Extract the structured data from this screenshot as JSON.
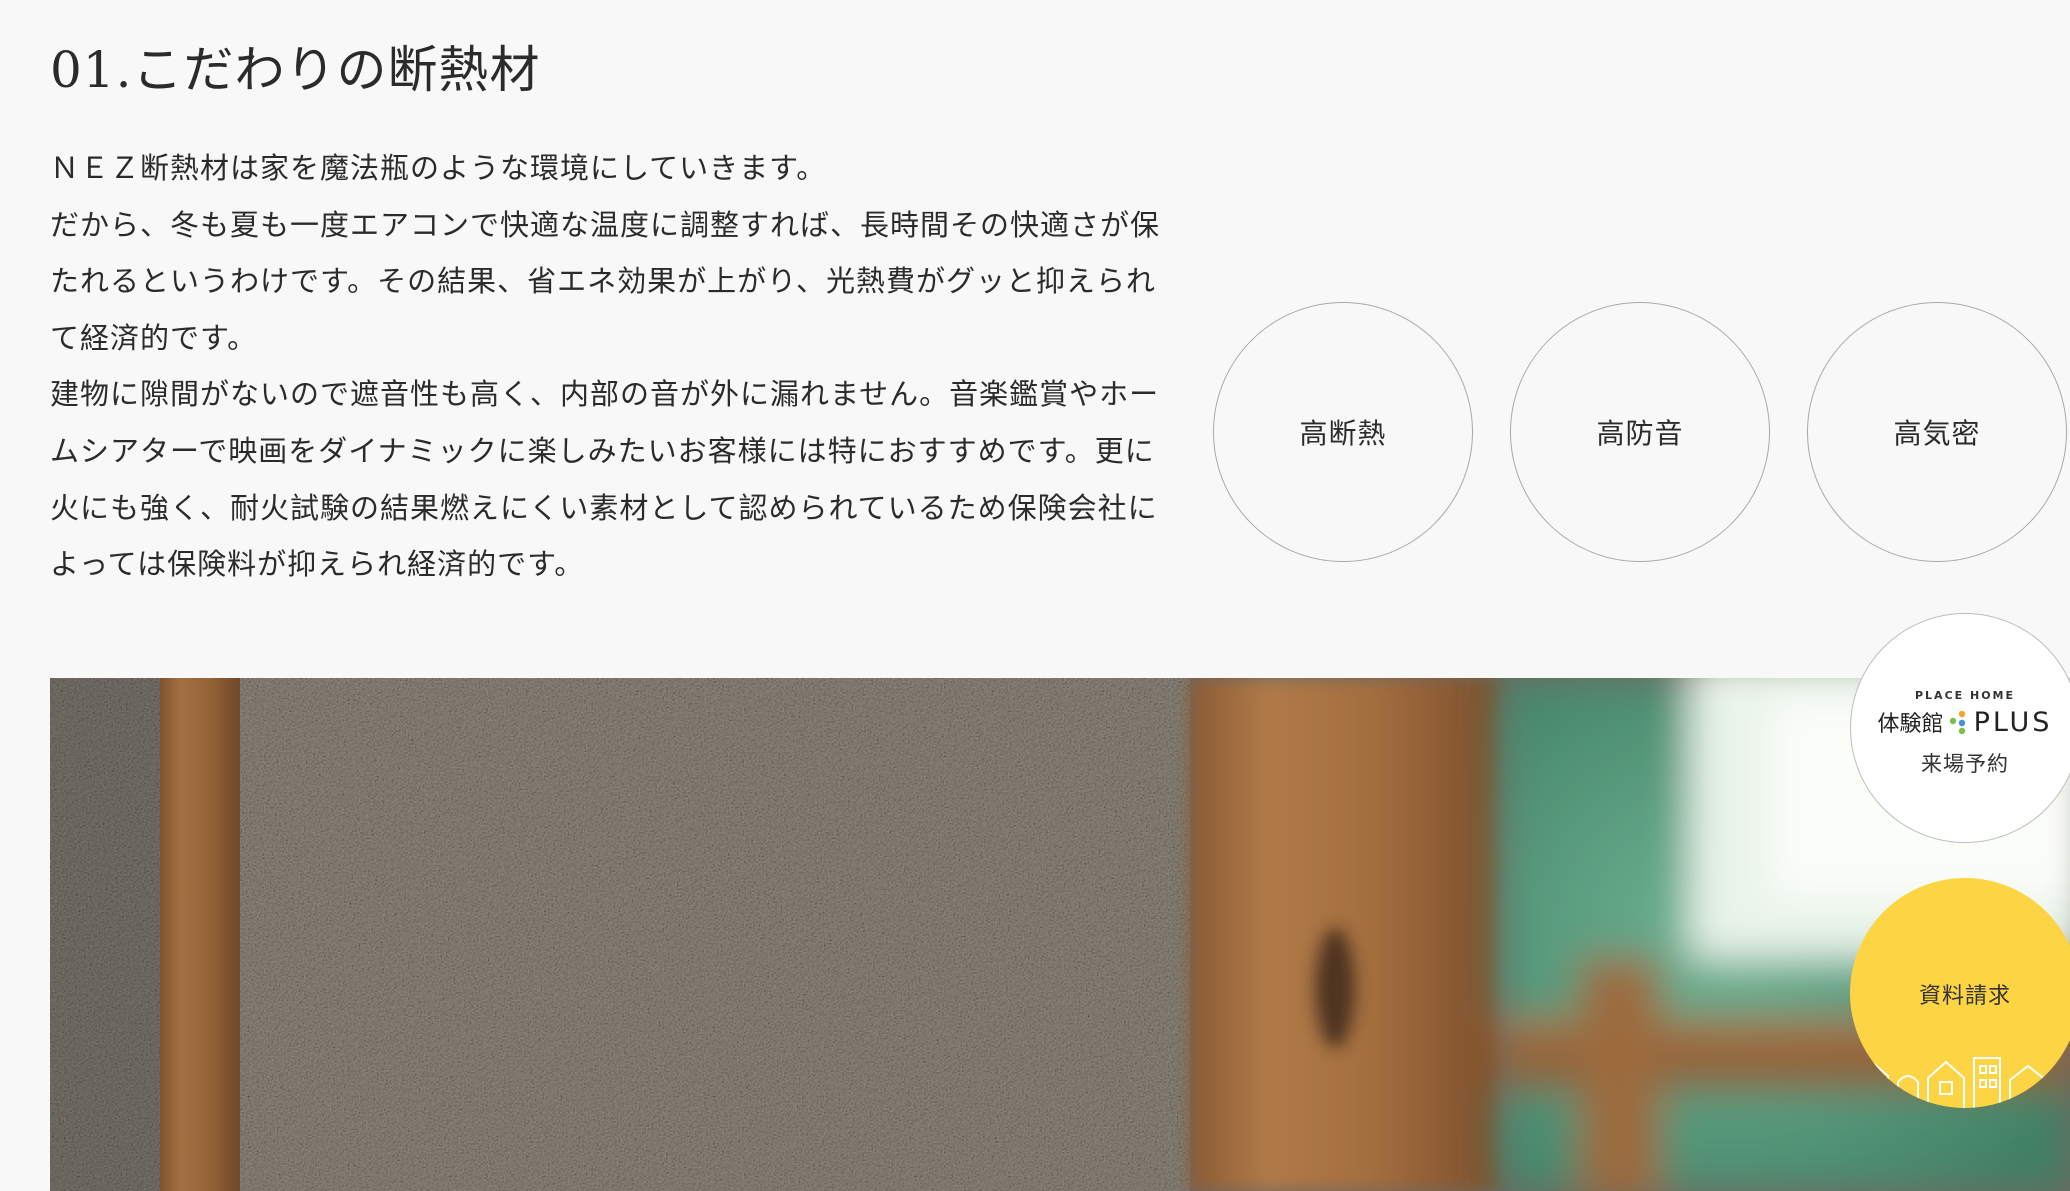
{
  "section": {
    "title": "01.こだわりの断熱材",
    "paragraphs": [
      "ＮＥＺ断熱材は家を魔法瓶のような環境にしていきます。",
      "だから、冬も夏も一度エアコンで快適な温度に調整すれば、長時間その快適さが保たれるというわけです。その結果、省エネ効果が上がり、光熱費がグッと抑えられて経済的です。",
      "建物に隙間がないので遮音性も高く、内部の音が外に漏れません。音楽鑑賞やホームシアターで映画をダイナミックに楽しみたいお客様には特におすすめです。更に火にも強く、耐火試験の結果燃えにくい素材として認められているため保険会社によっては保険料が抑えられ経済的です。"
    ]
  },
  "features": [
    "高断熱",
    "高防音",
    "高気密"
  ],
  "floating_buttons": {
    "visit": {
      "brand_top": "PLACE HOME",
      "brand_jp": "体験館",
      "brand_plus": "PLUS",
      "label": "来場予約"
    },
    "request": {
      "label": "資料請求"
    }
  },
  "colors": {
    "background": "#f8f8f8",
    "text": "#2b2b2b",
    "circle_border": "#a9a9a9",
    "request_button": "#fdd444"
  },
  "icons": [
    "place-home-logo-icon",
    "house-outline-icon"
  ]
}
